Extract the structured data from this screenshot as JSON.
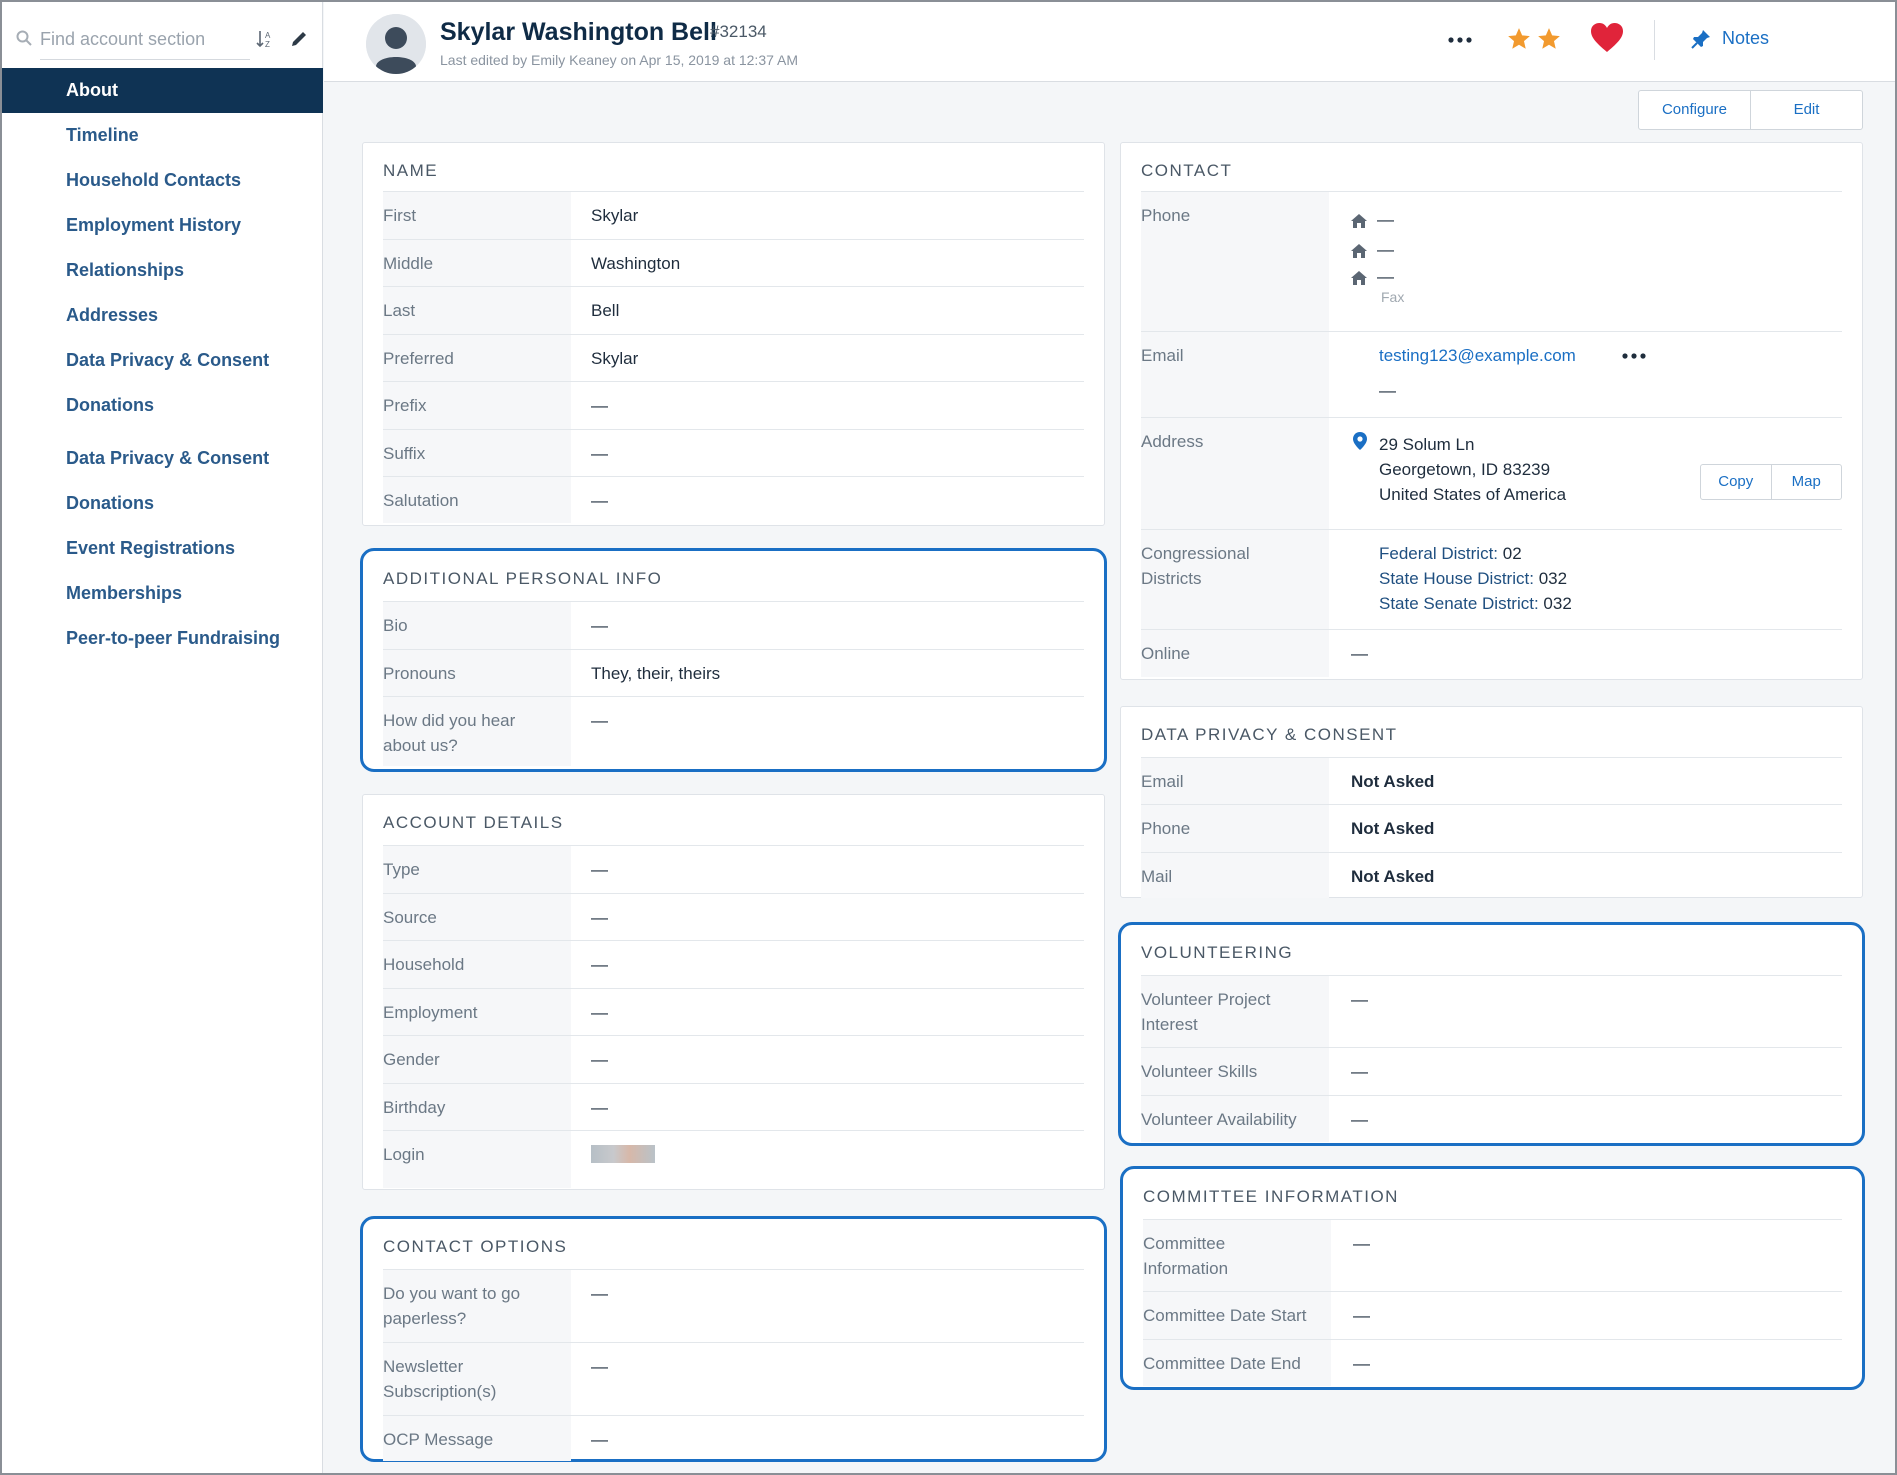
{
  "sidebar": {
    "search_placeholder": "Find account section",
    "items": [
      {
        "label": "About",
        "active": true
      },
      {
        "label": "Timeline"
      },
      {
        "label": "Household Contacts"
      },
      {
        "label": "Employment History"
      },
      {
        "label": "Relationships"
      },
      {
        "label": "Addresses"
      },
      {
        "label": "Data Privacy & Consent"
      },
      {
        "label": "Donations"
      },
      {
        "label": "Data Privacy & Consent"
      },
      {
        "label": "Donations"
      },
      {
        "label": "Event Registrations"
      },
      {
        "label": "Memberships"
      },
      {
        "label": "Peer-to-peer Fundraising"
      }
    ]
  },
  "header": {
    "name": "Skylar Washington Bell",
    "account_id": "#32134",
    "last_edited": "Last edited by Emily Keaney on Apr 15, 2019 at 12:37 AM",
    "notes_label": "Notes",
    "star_color": "#f29a2e",
    "heart_color": "#e0243a",
    "accent_color": "#1a6fc4"
  },
  "actions": {
    "configure_label": "Configure",
    "edit_label": "Edit"
  },
  "name_card": {
    "title": "NAME",
    "rows": [
      {
        "label": "First",
        "value": "Skylar"
      },
      {
        "label": "Middle",
        "value": "Washington"
      },
      {
        "label": "Last",
        "value": "Bell"
      },
      {
        "label": "Preferred",
        "value": "Skylar"
      },
      {
        "label": "Prefix",
        "value": "—"
      },
      {
        "label": "Suffix",
        "value": "—"
      },
      {
        "label": "Salutation",
        "value": "—"
      }
    ]
  },
  "personal_card": {
    "title": "ADDITIONAL PERSONAL INFO",
    "rows": [
      {
        "label": "Bio",
        "value": "—"
      },
      {
        "label": "Pronouns",
        "value": "They, their, theirs"
      },
      {
        "label1": "How did you hear",
        "label2": "about us?",
        "value": "—"
      }
    ]
  },
  "account_card": {
    "title": "ACCOUNT DETAILS",
    "rows": [
      {
        "label": "Type",
        "value": "—"
      },
      {
        "label": "Source",
        "value": "—"
      },
      {
        "label": "Household",
        "value": "—"
      },
      {
        "label": "Employment",
        "value": "—"
      },
      {
        "label": "Gender",
        "value": "—"
      },
      {
        "label": "Birthday",
        "value": "—"
      },
      {
        "label": "Login",
        "value": ""
      }
    ]
  },
  "contact_options_card": {
    "title": "CONTACT OPTIONS",
    "rows": [
      {
        "label1": "Do you want to go",
        "label2": "paperless?",
        "value": "—"
      },
      {
        "label1": "Newsletter",
        "label2": "Subscription(s)",
        "value": "—"
      },
      {
        "label": "OCP Message",
        "value": "—"
      }
    ]
  },
  "contact_card": {
    "title": "CONTACT",
    "phone_label": "Phone",
    "phones": [
      "—",
      "—",
      "—"
    ],
    "fax_label": "Fax",
    "email_label": "Email",
    "email": "testing123@example.com",
    "email2": "—",
    "address_label": "Address",
    "address_line1": "29 Solum Ln",
    "address_line2": "Georgetown, ID 83239",
    "address_line3": "United States of America",
    "copy_label": "Copy",
    "map_label": "Map",
    "districts_label1": "Congressional",
    "districts_label2": "Districts",
    "federal_label": "Federal District:",
    "federal_value": "02",
    "house_label": "State House District:",
    "house_value": "032",
    "senate_label": "State Senate District:",
    "senate_value": "032",
    "online_label": "Online",
    "online_value": "—"
  },
  "privacy_card": {
    "title": "DATA PRIVACY & CONSENT",
    "rows": [
      {
        "label": "Email",
        "value": "Not Asked"
      },
      {
        "label": "Phone",
        "value": "Not Asked"
      },
      {
        "label": "Mail",
        "value": "Not Asked"
      }
    ]
  },
  "volunteer_card": {
    "title": "VOLUNTEERING",
    "rows": [
      {
        "label1": "Volunteer Project",
        "label2": "Interest",
        "value": "—"
      },
      {
        "label": "Volunteer Skills",
        "value": "—"
      },
      {
        "label": "Volunteer Availability",
        "value": "—"
      }
    ]
  },
  "committee_card": {
    "title": "COMMITTEE INFORMATION",
    "rows": [
      {
        "label1": "Committee",
        "label2": "Information",
        "value": "—"
      },
      {
        "label": "Committee Date Start",
        "value": "—"
      },
      {
        "label": "Committee Date End",
        "value": "—"
      }
    ]
  }
}
